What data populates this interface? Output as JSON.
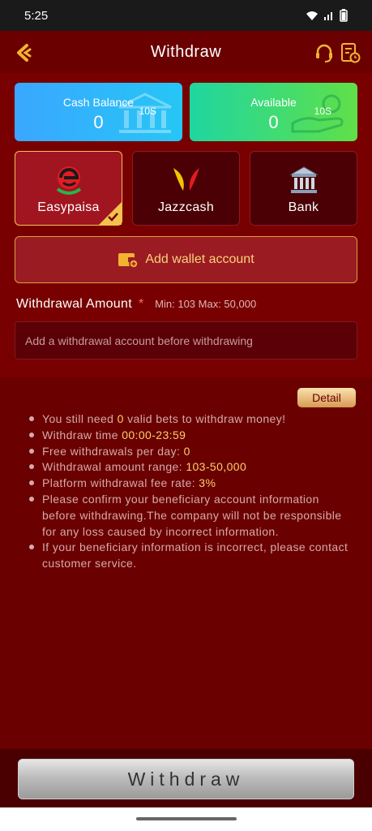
{
  "status_bar": {
    "time": "5:25"
  },
  "header": {
    "title": "Withdraw"
  },
  "balances": {
    "cash": {
      "label": "Cash Balance",
      "amount": "0",
      "unit": "10S"
    },
    "available": {
      "label": "Available",
      "amount": "0",
      "unit": "10S"
    }
  },
  "methods": [
    {
      "label": "Easypaisa",
      "selected": true
    },
    {
      "label": "Jazzcash",
      "selected": false
    },
    {
      "label": "Bank",
      "selected": false
    }
  ],
  "add_wallet": {
    "label": "Add wallet account"
  },
  "amount": {
    "title": "Withdrawal Amount",
    "required_mark": "*",
    "range": "Min: 103 Max: 50,000",
    "placeholder": "Add a withdrawal account before withdrawing"
  },
  "info": {
    "detail_label": "Detail",
    "rules": [
      {
        "pre": "You still need ",
        "hl": "0",
        "post": " valid bets to withdraw money!"
      },
      {
        "pre": "Withdraw time ",
        "hl": "00:00-23:59",
        "post": ""
      },
      {
        "pre": "Free withdrawals per day: ",
        "hl": "0",
        "post": ""
      },
      {
        "pre": "Withdrawal amount range: ",
        "hl": "103-50,000",
        "post": ""
      },
      {
        "pre": "Platform withdrawal fee rate: ",
        "hl": "3%",
        "post": ""
      },
      {
        "pre": "Please confirm your beneficiary account information before withdrawing.The company will not be responsible for any loss caused by incorrect information.",
        "hl": "",
        "post": ""
      },
      {
        "pre": "If your beneficiary information is incorrect, please contact customer service.",
        "hl": "",
        "post": ""
      }
    ]
  },
  "footer": {
    "withdraw_label": "Withdraw"
  },
  "colors": {
    "background": "#6b0000",
    "accent": "#f2c24e",
    "highlight": "#ffcf6b"
  }
}
